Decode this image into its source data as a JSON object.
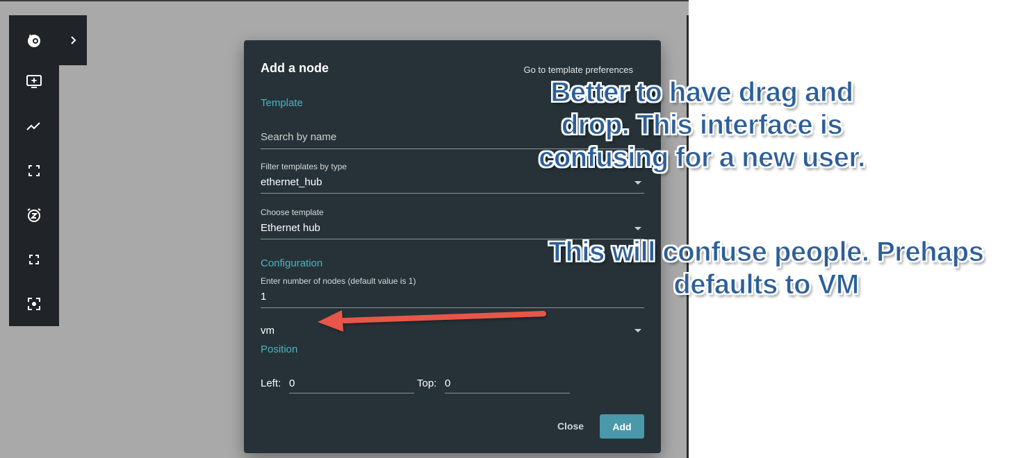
{
  "toolbar": {
    "icons": [
      "gns3-logo-icon",
      "add-node-monitor-icon",
      "trend-line-icon",
      "fit-view-icon",
      "snooze-alarm-icon",
      "fullscreen-icon",
      "screenshot-icon"
    ],
    "expand_icon": "chevron-right-icon"
  },
  "modal": {
    "title": "Add a node",
    "pref_link": "Go to template preferences",
    "template_section": "Template",
    "search_placeholder": "Search by name",
    "filter_label": "Filter templates by type",
    "filter_value": "ethernet_hub",
    "choose_label": "Choose template",
    "choose_value": "Ethernet hub",
    "config_section": "Configuration",
    "nodes_label": "Enter number of nodes (default value is 1)",
    "nodes_value": "1",
    "compute_value": "vm",
    "position_section": "Position",
    "left_label": "Left:",
    "left_value": "0",
    "top_label": "Top:",
    "top_value": "0",
    "close_label": "Close",
    "add_label": "Add"
  },
  "annotations": {
    "note1_lines": [
      "Better to have drag and",
      "drop. This interface is",
      "confusing for a new user."
    ],
    "note2_lines": [
      "This will confuse people. Prehaps",
      "defaults to VM"
    ]
  },
  "colors": {
    "accent": "#4fb3c0",
    "add_button": "#4a98aa",
    "modal_bg": "#263238",
    "annotation_text": "#2d5f99",
    "arrow": "#e8574a"
  }
}
